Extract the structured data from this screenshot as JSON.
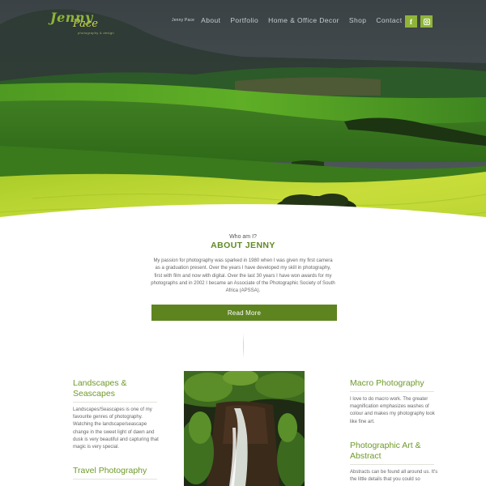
{
  "logo": {
    "name": "Jenny",
    "surname": "Pace",
    "subtitle": "photography & design"
  },
  "nav": {
    "home": "Jenny Pace",
    "items": [
      "About",
      "Portfolio",
      "Home & Office Decor",
      "Shop",
      "Contact"
    ]
  },
  "social": {
    "facebook": "f"
  },
  "about": {
    "eyebrow": "Who am I?",
    "title": "ABOUT JENNY",
    "text": "My passion for photography was sparked in 1980 when I was given my first camera as a graduation present. Over the years I have developed my skill in photography, first with film and now with digital. Over the last 30 years I have won awards for my photographs and in 2002 I became an Associate of the Photographic Society of South Africa (APSSA).",
    "button": "Read More"
  },
  "columns": {
    "left": [
      {
        "title": "Landscapes & Seascapes",
        "text": "Landscapes/Seascapes is one of my favourite genres of photography. Watching the landscape/seascape change in the sweet light of dawn and dusk is very beautiful and capturing that magic is very special."
      },
      {
        "title": "Travel Photography"
      }
    ],
    "right": [
      {
        "title": "Macro Photography",
        "text": "I love to do macro work. The greater magnification emphasizes washes of colour and makes my photography look like fine art."
      },
      {
        "title": "Photographic Art & Abstract",
        "text": "Abstracts can be found all around us. It's the little details that you could so"
      }
    ]
  },
  "colors": {
    "accent": "#5e8420",
    "accent_light": "#8fb43a",
    "title_green": "#6e9a2a"
  }
}
